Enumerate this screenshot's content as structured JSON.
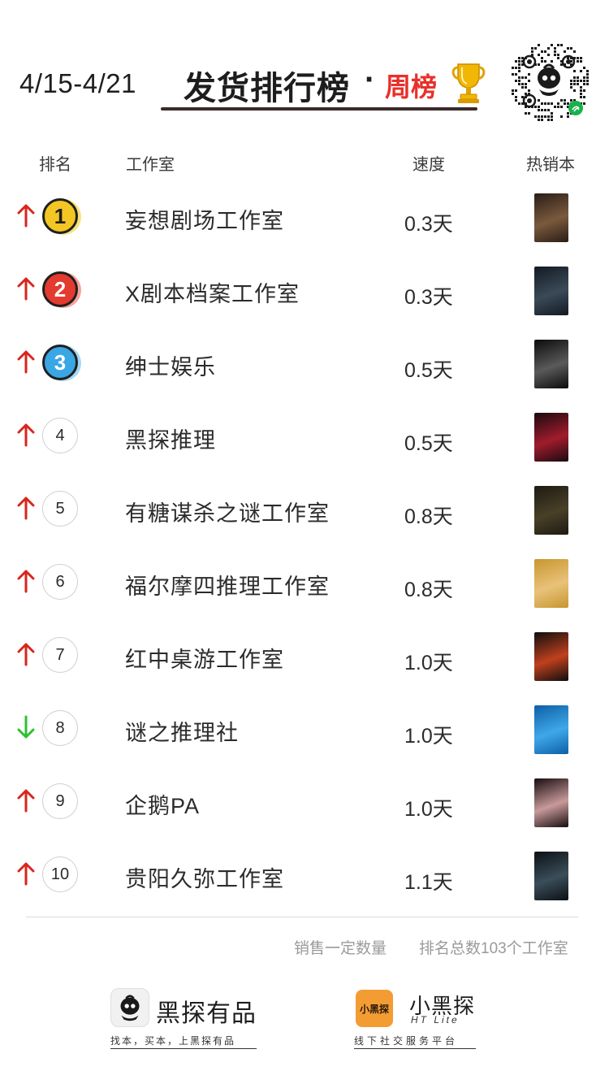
{
  "header": {
    "date_range": "4/15-4/21",
    "title": "发货排行榜",
    "title_dot": "·",
    "subtitle": "周榜",
    "trophy_icon": "trophy-icon",
    "qr_icon": "qr-code-icon"
  },
  "columns": {
    "rank": "排名",
    "studio": "工作室",
    "speed": "速度",
    "hot": "热销本"
  },
  "rows": [
    {
      "trend": "up",
      "rank": "1",
      "medal": "gold",
      "studio": "妄想剧场工作室",
      "speed": "0.3天",
      "cover_colors": [
        "#2a1d16",
        "#7a5a3e"
      ]
    },
    {
      "trend": "up",
      "rank": "2",
      "medal": "red",
      "studio": "X剧本档案工作室",
      "speed": "0.3天",
      "cover_colors": [
        "#121a22",
        "#3b4a58"
      ]
    },
    {
      "trend": "up",
      "rank": "3",
      "medal": "blue",
      "studio": "绅士娱乐",
      "speed": "0.5天",
      "cover_colors": [
        "#0b0b0b",
        "#5a5a5a"
      ]
    },
    {
      "trend": "up",
      "rank": "4",
      "medal": "",
      "studio": "黑探推理",
      "speed": "0.5天",
      "cover_colors": [
        "#1a0a10",
        "#a01c2c"
      ]
    },
    {
      "trend": "up",
      "rank": "5",
      "medal": "",
      "studio": "有糖谋杀之谜工作室",
      "speed": "0.8天",
      "cover_colors": [
        "#1c1a12",
        "#4a4028"
      ]
    },
    {
      "trend": "up",
      "rank": "6",
      "medal": "",
      "studio": "福尔摩四推理工作室",
      "speed": "0.8天",
      "cover_colors": [
        "#c8962e",
        "#e8c27a"
      ]
    },
    {
      "trend": "up",
      "rank": "7",
      "medal": "",
      "studio": "红中桌游工作室",
      "speed": "1.0天",
      "cover_colors": [
        "#0e0e0e",
        "#c0401e"
      ]
    },
    {
      "trend": "down",
      "rank": "8",
      "medal": "",
      "studio": "谜之推理社",
      "speed": "1.0天",
      "cover_colors": [
        "#0d5fa6",
        "#3fa8e8"
      ]
    },
    {
      "trend": "up",
      "rank": "9",
      "medal": "",
      "studio": "企鹅PA",
      "speed": "1.0天",
      "cover_colors": [
        "#180c10",
        "#c89a9a"
      ]
    },
    {
      "trend": "up",
      "rank": "10",
      "medal": "",
      "studio": "贵阳久弥工作室",
      "speed": "1.1天",
      "cover_colors": [
        "#0c1014",
        "#3a4e5a"
      ]
    }
  ],
  "footer": {
    "note_left": "销售一定数量",
    "note_right": "排名总数103个工作室",
    "brand1_name": "黑探有品",
    "brand1_tagline": "找本，买本，上黑探有品",
    "brand2_logo_text": "小黑探",
    "brand2_name": "小黑探",
    "brand2_sub": "HT Lite",
    "brand2_tagline": "线下社交服务平台"
  },
  "colors": {
    "arrow_up": "#d7261e",
    "arrow_down": "#2fbf2f",
    "title_accent": "#e8302a"
  }
}
